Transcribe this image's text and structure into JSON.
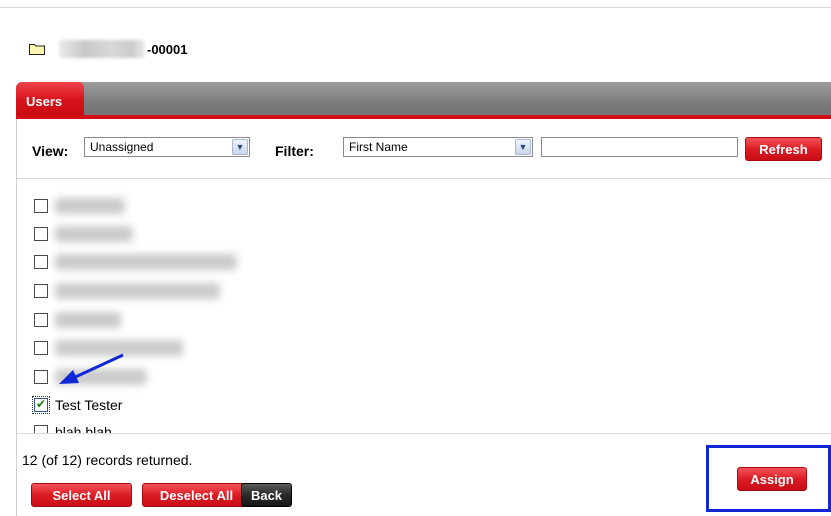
{
  "record": {
    "id_suffix": "-00001",
    "icon": "folder-icon"
  },
  "tabs": [
    {
      "label": "Users",
      "active": true
    }
  ],
  "toolbar": {
    "view_label": "View:",
    "view_value": "Unassigned",
    "filter_label": "Filter:",
    "filter_value": "First Name",
    "filter_text": "",
    "refresh_label": "Refresh"
  },
  "users": [
    {
      "name": "",
      "checked": false
    },
    {
      "name": "",
      "checked": false
    },
    {
      "name": "",
      "checked": false
    },
    {
      "name": "",
      "checked": false
    },
    {
      "name": "",
      "checked": false
    },
    {
      "name": "",
      "checked": false
    },
    {
      "name": "",
      "checked": false
    },
    {
      "name": "Test Tester",
      "checked": true
    },
    {
      "name": "blah blah",
      "checked": false
    }
  ],
  "footer": {
    "records_text": "12 (of 12) records returned.",
    "select_all_label": "Select All",
    "deselect_all_label": "Deselect All",
    "back_label": "Back",
    "assign_label": "Assign"
  },
  "colors": {
    "accent_red": "#d20f16",
    "annotation_blue": "#1027d8"
  }
}
